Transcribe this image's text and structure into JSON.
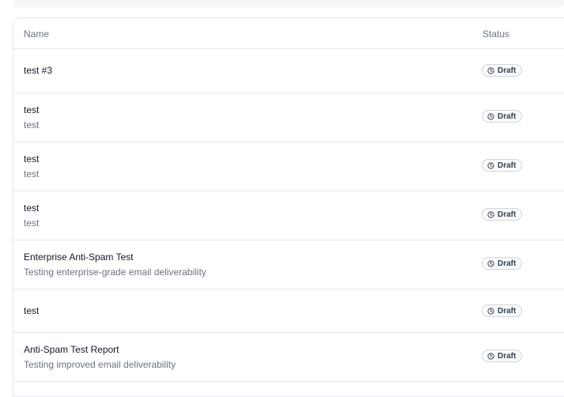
{
  "table": {
    "headers": {
      "name": "Name",
      "status": "Status"
    },
    "rows": [
      {
        "name": "test #3",
        "description": "",
        "status": "Draft"
      },
      {
        "name": "test",
        "description": "test",
        "status": "Draft"
      },
      {
        "name": "test",
        "description": "test",
        "status": "Draft"
      },
      {
        "name": "test",
        "description": "test",
        "status": "Draft"
      },
      {
        "name": "Enterprise Anti-Spam Test",
        "description": "Testing enterprise-grade email deliverability",
        "status": "Draft"
      },
      {
        "name": "test",
        "description": "",
        "status": "Draft"
      },
      {
        "name": "Anti-Spam Test Report",
        "description": "Testing improved email deliverability",
        "status": "Draft"
      }
    ]
  },
  "badge_icon": "clock-icon",
  "colors": {
    "border": "#e5e7eb",
    "muted_text": "#6b7280",
    "badge_border": "#d1d5db"
  }
}
